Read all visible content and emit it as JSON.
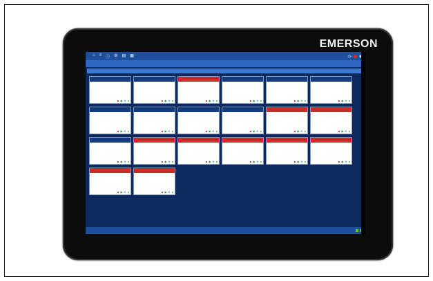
{
  "brand": "EMERSON",
  "topbar": {
    "title": "",
    "icons": [
      "home-icon",
      "list-icon",
      "info-icon",
      "settings-icon",
      "chart-icon",
      "grid-icon"
    ]
  },
  "subbar": {
    "label": "",
    "buttons": [
      "",
      ""
    ]
  },
  "section_title": "",
  "cards": [
    {
      "state": "normal"
    },
    {
      "state": "normal"
    },
    {
      "state": "alarm"
    },
    {
      "state": "normal"
    },
    {
      "state": "normal"
    },
    {
      "state": "normal"
    },
    {
      "state": "normal"
    },
    {
      "state": "normal"
    },
    {
      "state": "normal"
    },
    {
      "state": "normal"
    },
    {
      "state": "alarm"
    },
    {
      "state": "alarm"
    },
    {
      "state": "normal"
    },
    {
      "state": "alarm"
    },
    {
      "state": "alarm"
    },
    {
      "state": "alarm"
    },
    {
      "state": "alarm"
    },
    {
      "state": "alarm"
    },
    {
      "state": "alarm"
    },
    {
      "state": "alarm"
    }
  ],
  "green_bar_label": "",
  "blue_band_label": "",
  "status": {
    "left": "",
    "right": ""
  },
  "colors": {
    "alarm": "#cf2a2a",
    "normal_header": "#123c7c",
    "ok": "#6bbf2a",
    "screen_bg": "#0d2a5e"
  }
}
